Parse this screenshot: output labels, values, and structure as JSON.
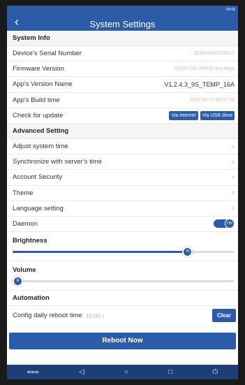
{
  "status": {
    "time": "00:06",
    "signal": "◌"
  },
  "header": {
    "back_icon": "‹",
    "title": "System Settings"
  },
  "system_info": {
    "title": "System Info",
    "serial_label": "Device's Serial Number",
    "serial_value": "863424400234210",
    "firmware_label": "Firmware Version",
    "firmware_value": "20200703.154635 test-keys",
    "app_version_label": "App's Version Name",
    "app_version_value": "V1.2.4.3_9S_TEMP_16A",
    "build_time_label": "App's Build time",
    "build_time_value": "2020-08-17 09:37:56",
    "update_label": "Check for update",
    "via_internet": "Via internet",
    "via_usb": "Via USB drive"
  },
  "advanced": {
    "title": "Advanced Setting",
    "items": [
      {
        "label": "Adjust system time"
      },
      {
        "label": "Synchronize with server's time"
      },
      {
        "label": "Account Security"
      },
      {
        "label": "Theme"
      },
      {
        "label": "Language setting"
      }
    ],
    "daemon_label": "Daemon",
    "daemon_state": "ON",
    "chevron": "›"
  },
  "brightness": {
    "label": "Brightness",
    "level": 0.79,
    "thumb_text": "III"
  },
  "volume": {
    "label": "Volume",
    "level": 0.0,
    "thumb_text": "III"
  },
  "automation": {
    "title": "Automation",
    "reboot_label": "Config daily reboot time",
    "reboot_time": "15:00 ›",
    "clear_label": "Clear",
    "reboot_now_label": "Reboot Now"
  },
  "navbar": {
    "menu": "⩶",
    "back": "◁",
    "home": "○",
    "recent": "□",
    "power": "⏻"
  },
  "colors": {
    "accent": "#2c5ba7",
    "nav": "#1d3f76"
  }
}
